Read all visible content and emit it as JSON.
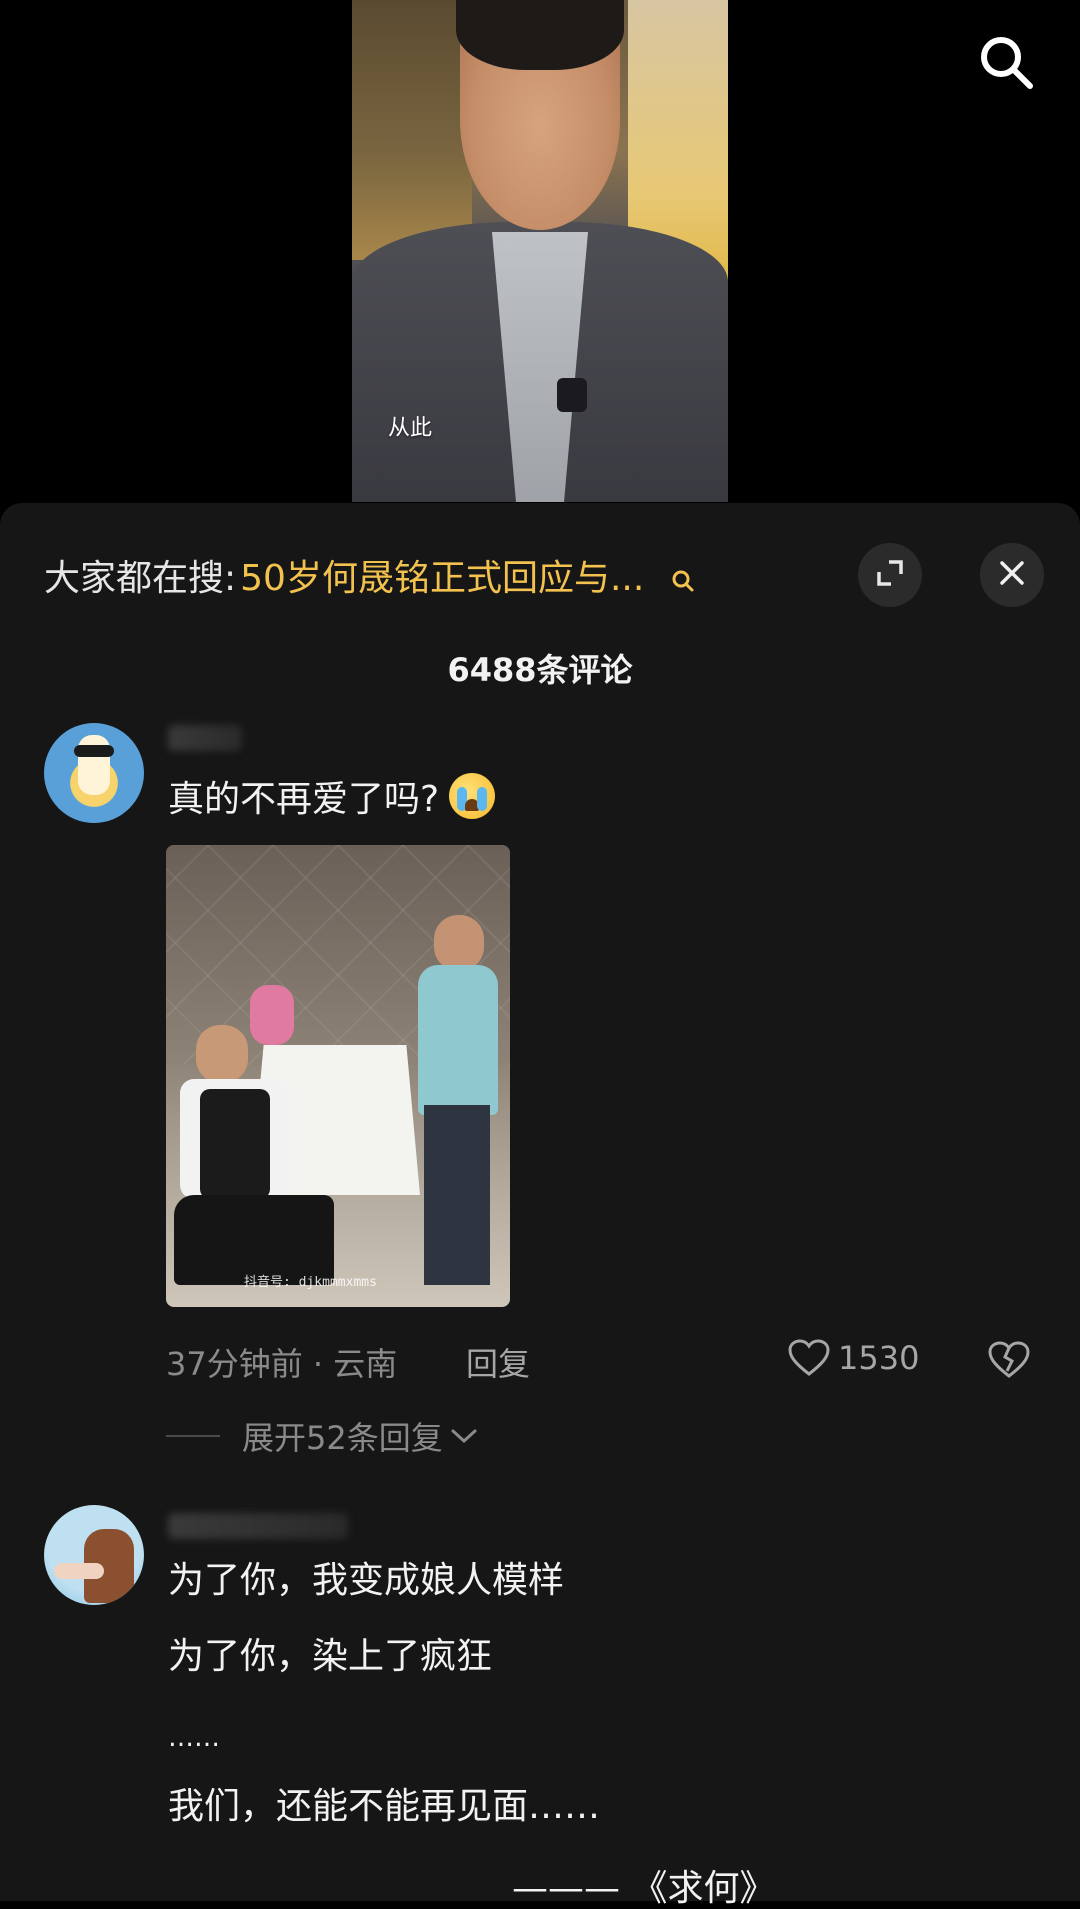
{
  "video": {
    "caption": "从此"
  },
  "icons": {
    "top_search": "search-icon",
    "mini_search": "search-icon",
    "expand": "expand-icon",
    "close": "close-icon",
    "like": "heart-outline-icon",
    "dislike": "broken-heart-icon",
    "chevron": "chevron-down-icon"
  },
  "colors": {
    "sheet_bg": "#161616",
    "search_query": "#f2c14e",
    "meta_text": "#8a8a8a"
  },
  "search": {
    "prefix": "大家都在搜:",
    "query": "50岁何晟铭正式回应与..."
  },
  "comments_header": {
    "count_label": "6488条评论"
  },
  "comments": [
    {
      "text": "真的不再爱了吗?",
      "image_watermark": "抖音号: djkmmmxmms",
      "time_location": "37分钟前 · 云南",
      "reply_label": "回复",
      "likes": "1530",
      "expand_replies": "展开52条回复"
    },
    {
      "lines": [
        "为了你，我变成娘人模样",
        "为了你，染上了疯狂",
        "……",
        "我们，还能不能再见面……",
        "——— 《求何》"
      ]
    }
  ]
}
